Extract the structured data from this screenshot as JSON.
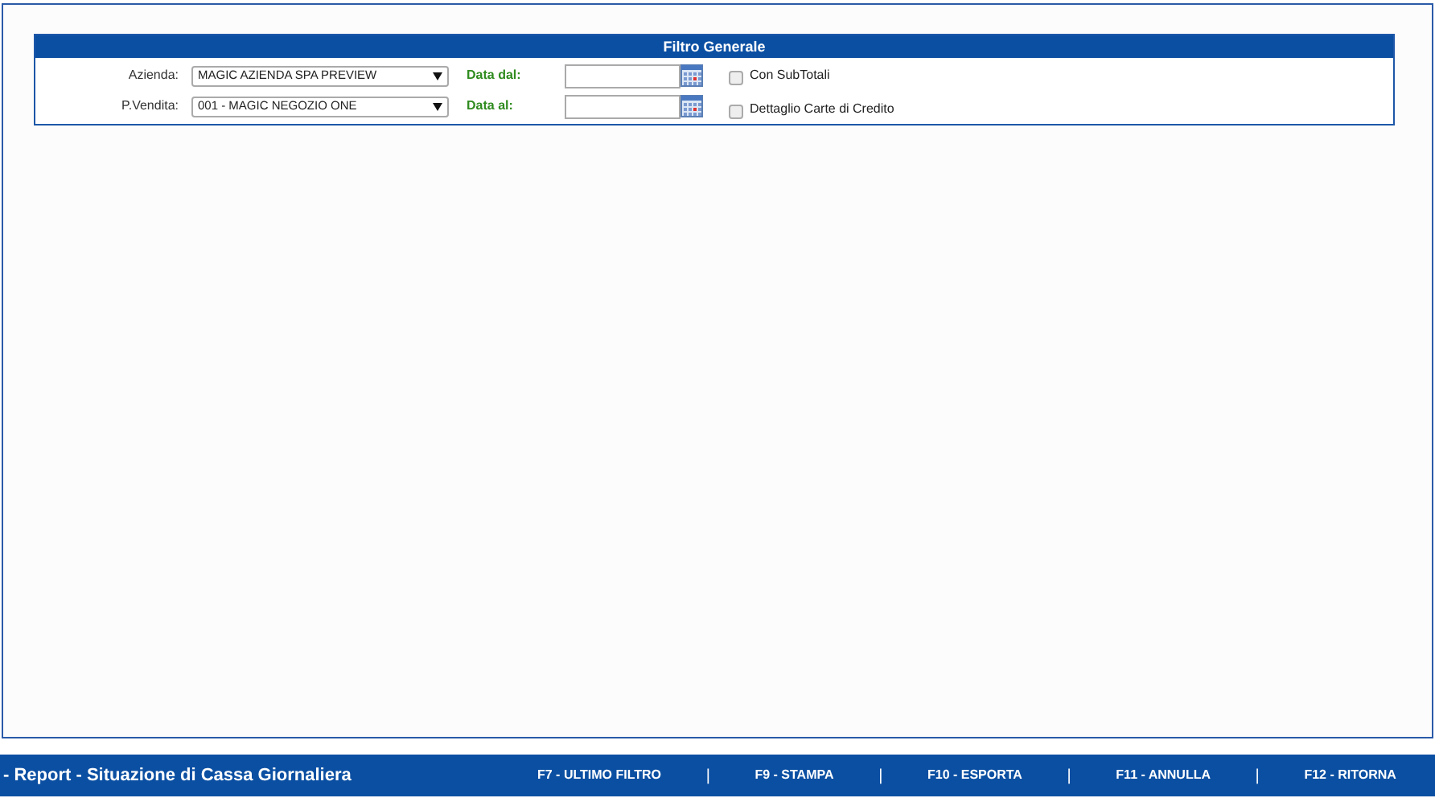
{
  "filter": {
    "title": "Filtro Generale",
    "rows": [
      {
        "label": "Azienda:",
        "select": "MAGIC AZIENDA SPA PREVIEW",
        "date_label": "Data dal:",
        "checkbox": {
          "label": "Con SubTotali",
          "checked": false
        }
      },
      {
        "label": "P.Vendita:",
        "select": "001 - MAGIC NEGOZIO ONE",
        "date_label": "Data al:",
        "checkbox": {
          "label": "Dettaglio Carte di Credito",
          "checked": false
        }
      }
    ]
  },
  "footer": {
    "title": "- Report - Situazione di Cassa Giornaliera",
    "items": [
      {
        "kind": "action",
        "text": "F7 - ULTIMO FILTRO"
      },
      {
        "kind": "separator",
        "text": "|"
      },
      {
        "kind": "action",
        "text": "F9 - STAMPA"
      },
      {
        "kind": "separator",
        "text": "|"
      },
      {
        "kind": "action",
        "text": "F10 - ESPORTA"
      },
      {
        "kind": "separator",
        "text": "|"
      },
      {
        "kind": "action",
        "text": "F11 - ANNULLA"
      },
      {
        "kind": "separator",
        "text": "|"
      },
      {
        "kind": "action",
        "text": "F12 - RITORNA"
      }
    ]
  }
}
